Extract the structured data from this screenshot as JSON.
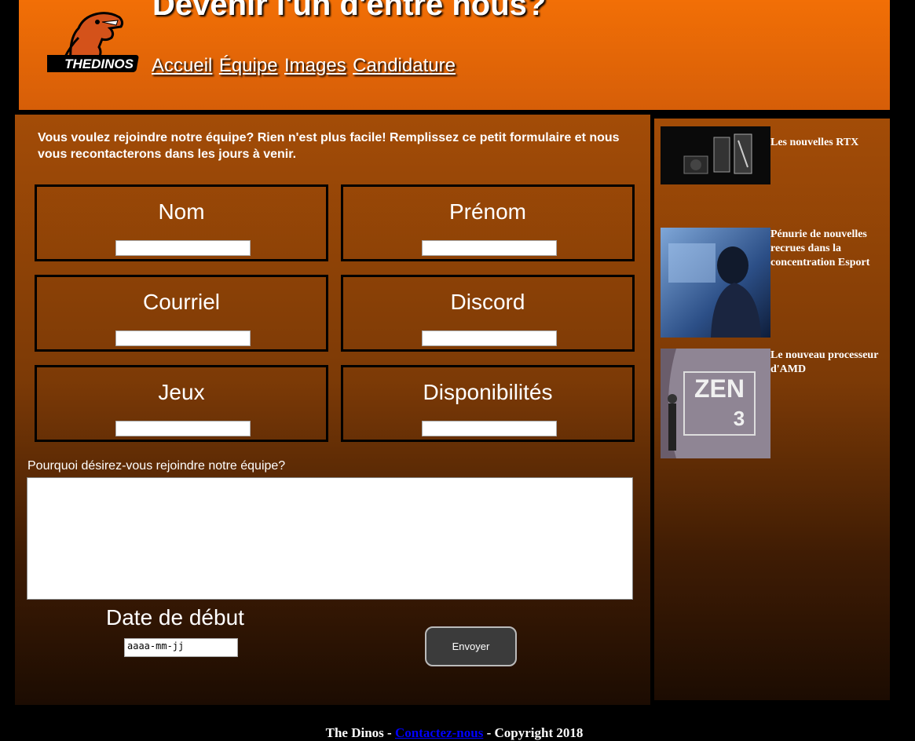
{
  "header": {
    "title": "Devenir l'un d'entre nous?",
    "logo_text": "THEDINOS",
    "nav": [
      "Accueil",
      "Équipe",
      "Images",
      "Candidature"
    ]
  },
  "form": {
    "intro": "Vous voulez rejoindre notre équipe? Rien n'est plus facile! Remplissez ce petit formulaire et nous vous recontacterons dans les jours à venir.",
    "fields": [
      {
        "label": "Nom",
        "value": ""
      },
      {
        "label": "Prénom",
        "value": ""
      },
      {
        "label": "Courriel",
        "value": ""
      },
      {
        "label": "Discord",
        "value": ""
      },
      {
        "label": "Jeux",
        "value": ""
      },
      {
        "label": "Disponibilités",
        "value": ""
      }
    ],
    "why_label": "Pourquoi désirez-vous rejoindre notre équipe?",
    "why_value": "",
    "date_label": "Date de début",
    "date_placeholder": "aaaa-mm-jj",
    "submit_label": "Envoyer"
  },
  "news": [
    {
      "title": "Les nouvelles RTX",
      "image": "graphics-cards-photo"
    },
    {
      "title": "Pénurie de nouvelles recrues dans la concentration Esport",
      "image": "gamer-photo"
    },
    {
      "title": "Le nouveau processeur d'AMD",
      "image": "zen3-photo"
    }
  ],
  "footer": {
    "prefix": "The Dinos - ",
    "link": "Contactez-nous",
    "suffix": " - Copyright 2018"
  },
  "colors": {
    "header_orange": "#f26f06",
    "panel_brown": "#a34c07",
    "button_gray": "#3b3b3b",
    "link_blue": "#0000ff"
  }
}
